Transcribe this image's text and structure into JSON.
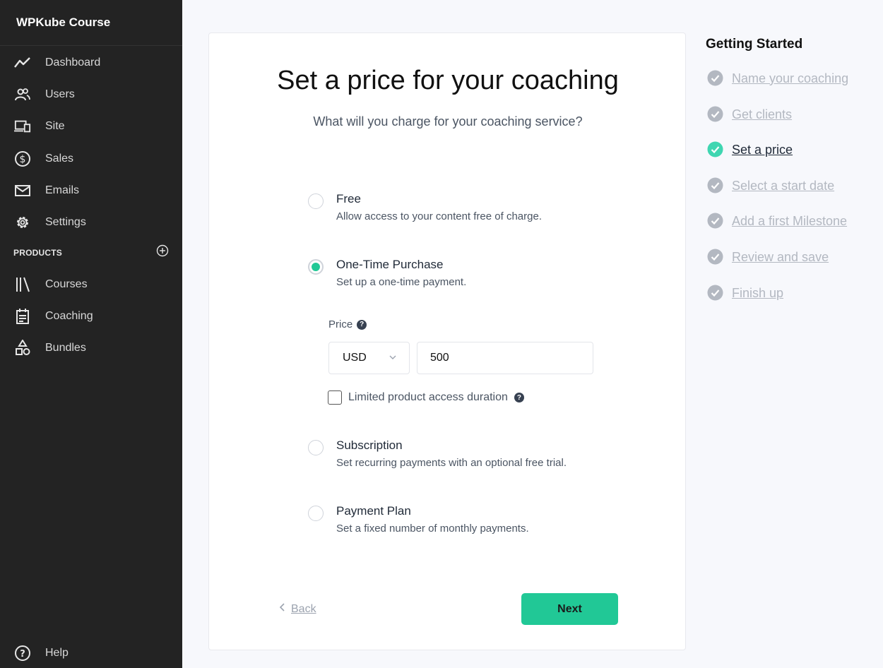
{
  "app": {
    "brand": "WPKube Course"
  },
  "sidebar": {
    "items": [
      {
        "label": "Dashboard",
        "icon": "trend-line-icon"
      },
      {
        "label": "Users",
        "icon": "users-icon"
      },
      {
        "label": "Site",
        "icon": "devices-icon"
      },
      {
        "label": "Sales",
        "icon": "dollar-circle-icon"
      },
      {
        "label": "Emails",
        "icon": "envelope-icon"
      },
      {
        "label": "Settings",
        "icon": "gear-icon"
      }
    ],
    "products_label": "PRODUCTS",
    "product_items": [
      {
        "label": "Courses",
        "icon": "library-icon"
      },
      {
        "label": "Coaching",
        "icon": "calendar-icon"
      },
      {
        "label": "Bundles",
        "icon": "shapes-icon"
      }
    ],
    "help_label": "Help"
  },
  "main": {
    "title": "Set a price for your coaching",
    "subtitle": "What will you charge for your coaching service?",
    "options": [
      {
        "title": "Free",
        "desc": "Allow access to your content free of charge.",
        "selected": false
      },
      {
        "title": "One-Time Purchase",
        "desc": "Set up a one-time payment.",
        "selected": true
      },
      {
        "title": "Subscription",
        "desc": "Set recurring payments with an optional free trial.",
        "selected": false
      },
      {
        "title": "Payment Plan",
        "desc": "Set a fixed number of monthly payments.",
        "selected": false
      }
    ],
    "price_label": "Price",
    "currency": "USD",
    "price_value": "500",
    "limited_access_label": "Limited product access duration",
    "limited_access_checked": false,
    "back_label": "Back",
    "next_label": "Next"
  },
  "steps": {
    "title": "Getting Started",
    "items": [
      {
        "label": "Name your coaching",
        "active": false
      },
      {
        "label": "Get clients",
        "active": false
      },
      {
        "label": "Set a price",
        "active": true
      },
      {
        "label": "Select a start date",
        "active": false
      },
      {
        "label": "Add a first Milestone",
        "active": false
      },
      {
        "label": "Review and save",
        "active": false
      },
      {
        "label": "Finish up",
        "active": false
      }
    ]
  },
  "colors": {
    "accent": "#21c896",
    "sidebar_bg": "#232323",
    "step_inactive": "#b3b8c1"
  }
}
